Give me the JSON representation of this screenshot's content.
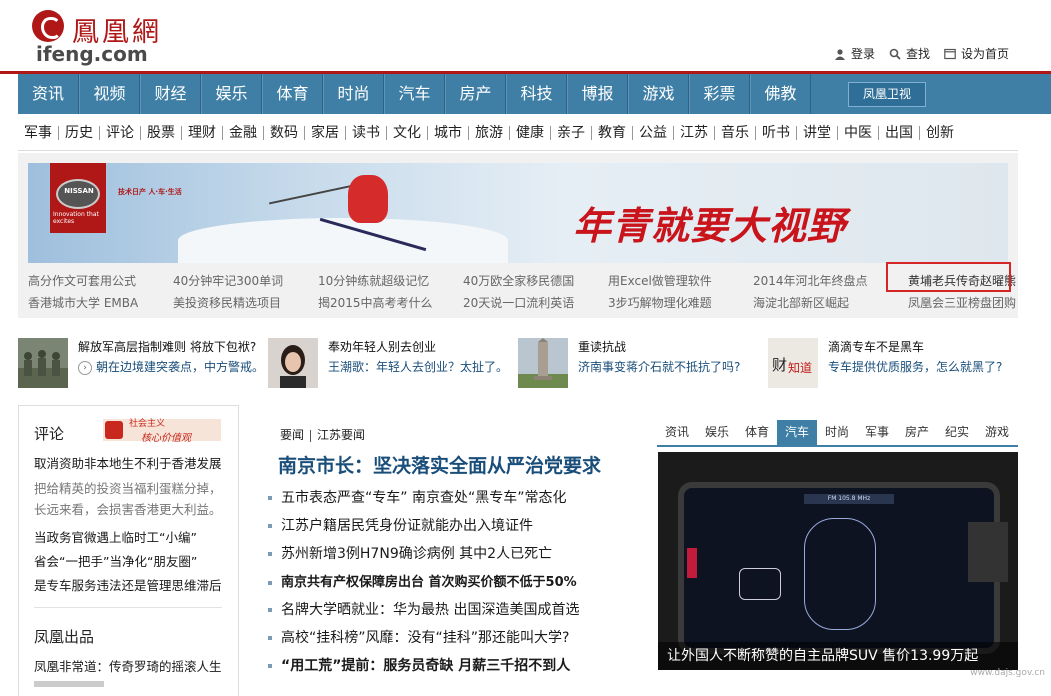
{
  "header": {
    "logo_cn": "鳳凰網",
    "logo_en": "ifeng.com",
    "links": [
      {
        "label": "登录",
        "icon": "user-icon"
      },
      {
        "label": "查找",
        "icon": "search-icon"
      },
      {
        "label": "设为首页",
        "icon": "window-icon"
      }
    ]
  },
  "nav": {
    "items": [
      "资讯",
      "视频",
      "财经",
      "娱乐",
      "体育",
      "时尚",
      "汽车",
      "房产",
      "科技",
      "博报",
      "游戏",
      "彩票",
      "佛教"
    ],
    "tv_label": "凤凰卫视"
  },
  "subnav": [
    "军事",
    "历史",
    "评论",
    "股票",
    "理财",
    "金融",
    "数码",
    "家居",
    "读书",
    "文化",
    "城市",
    "旅游",
    "健康",
    "亲子",
    "教育",
    "公益",
    "江苏",
    "音乐",
    "听书",
    "讲堂",
    "中医",
    "出国",
    "创新"
  ],
  "ad": {
    "brand": "NISSAN",
    "brand_tag": "Innovation that excites",
    "small_slogan": "技术日产 人·车·生活",
    "slogan": "年青就要大视野",
    "links_row1": [
      "高分作文可套用公式",
      "40分钟牢记300单词",
      "10分钟练就超级记忆",
      "40万欧全家移民德国",
      "用Excel做管理软件",
      "2014年河北年终盘点",
      "黄埔老兵传奇赵曜熊"
    ],
    "links_row2": [
      "香港城市大学 EMBA",
      "美投资移民精选项目",
      "揭2015中高考考什么",
      "20天说一口流利英语",
      "3步巧解物理化难题",
      "海淀北部新区崛起",
      "凤凰会三亚榜盘团购"
    ]
  },
  "strip": [
    {
      "title": "解放军高层指制难则 将放下包袱?",
      "desc": "朝在边境建突袭点，中方警戒。",
      "thumb": "soldiers"
    },
    {
      "title": "奉劝年轻人别去创业",
      "desc": "王潮歌：年轻人去创业？太扯了。",
      "thumb": "woman-portrait"
    },
    {
      "title": "重读抗战",
      "desc": "济南事变蒋介石就不抵抗了吗?",
      "thumb": "monument"
    },
    {
      "title": "滴滴专车不是黑车",
      "desc": "专车提供优质服务，怎么就黑了?",
      "thumb": "caijing-logo"
    }
  ],
  "left": {
    "section1_title": "评论",
    "badge_text_1": "社会主义",
    "badge_text_2": "核心价值观",
    "links1": [
      {
        "text": "取消资助非本地生不利于香港发展",
        "gray": false
      },
      {
        "text": "把给精英的投资当福利蛋糕分掉，",
        "gray": true
      },
      {
        "text": "长远来看，会损害香港更大利益。",
        "gray": true
      },
      {
        "text": "当政务官微遇上临时工“小编”",
        "gray": false
      },
      {
        "text": "省会“一把手”当净化“朋友圈”",
        "gray": false
      },
      {
        "text": "是专车服务违法还是管理思维滞后",
        "gray": false
      }
    ],
    "section2_title": "凤凰出品",
    "links2": [
      "凤凰非常道：传奇罗琦的摇滚人生"
    ]
  },
  "center": {
    "tab1": "要闻",
    "tab2": "江苏要闻",
    "headline": "南京市长：坚决落实全面从严治党要求",
    "items": [
      {
        "text": "五市表态严查“专车” 南京查处“黑专车”常态化",
        "bold": false
      },
      {
        "text": "江苏户籍居民凭身份证就能办出入境证件",
        "bold": false
      },
      {
        "text": "苏州新增3例H7N9确诊病例 其中2人已死亡",
        "bold": false
      },
      {
        "text": "南京共有产权保障房出台 首次购买价额不低于50%",
        "bold": true
      },
      {
        "text": "名牌大学晒就业：华为最热 出国深造美国成首选",
        "bold": false
      },
      {
        "text": "高校“挂科榜”风靡：没有“挂科”那还能叫大学?",
        "bold": false
      },
      {
        "text": "“用工荒”提前：服务员奇缺 月薪三千招不到人",
        "bold": true
      }
    ]
  },
  "right": {
    "tabs": [
      "资讯",
      "娱乐",
      "体育",
      "汽车",
      "时尚",
      "军事",
      "房产",
      "纪实",
      "游戏"
    ],
    "active_tab": "汽车",
    "caption": "让外国人不断称赞的自主品牌SUV 售价13.99万起",
    "screen_bar": "FM 105.8 MHz"
  },
  "watermark": "www.dajs.gov.cn",
  "colors": {
    "brand_red": "#b01818",
    "nav_blue": "#3f7fa6",
    "link_blue": "#1a4e7a"
  }
}
